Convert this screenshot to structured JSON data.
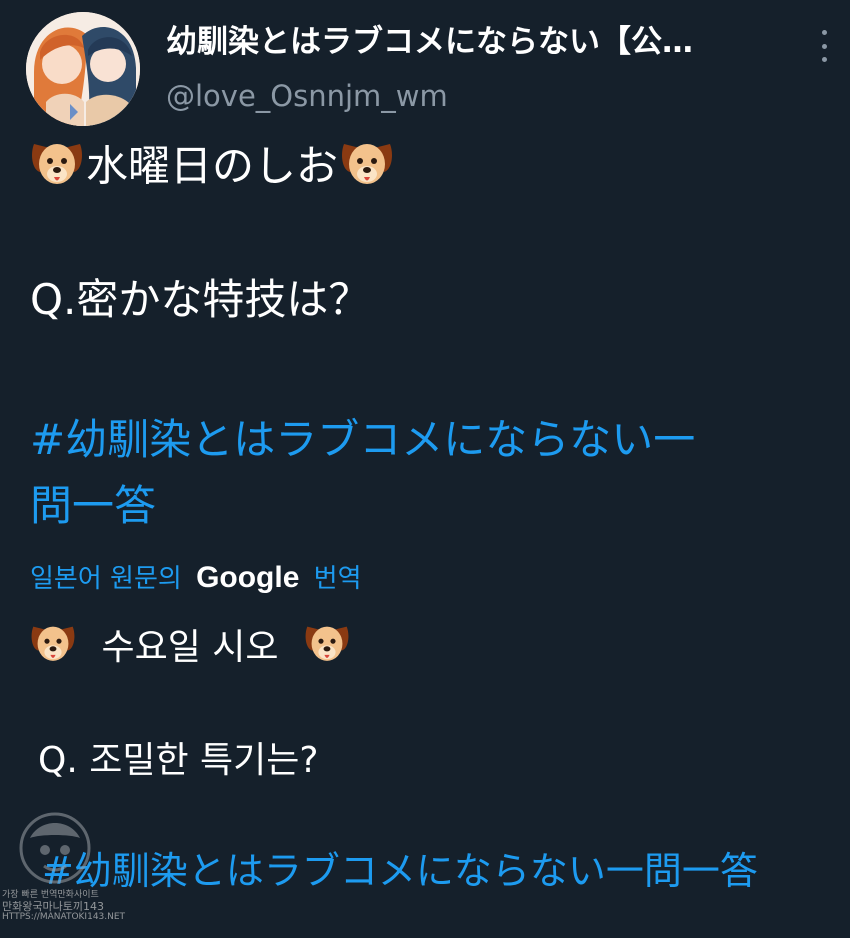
{
  "account": {
    "name": "幼馴染とはラブコメにならない【公…",
    "handle": "@love_Osnnjm_wm"
  },
  "tweet": {
    "line1": "水曜日のしお",
    "line2": "Q.密かな特技は？",
    "hashtag_line1": "#幼馴染とはラブコメにならない一",
    "hashtag_line2": "問一答"
  },
  "translation": {
    "prefix": "일본어 원문의",
    "provider": "Google",
    "suffix": "번역",
    "line1": "수요일 시오",
    "line2": "Q. 조밀한 특기는?",
    "hashtag": "#幼馴染とはラブコメにならない一問一答"
  },
  "watermark": {
    "line1": "가장 빠른 번역만화사이트",
    "line2": "만화왕국마나토끼143",
    "line3": "HTTPS://MANATOKI143.NET"
  },
  "icons": {
    "dog": "dog-face-emoji",
    "more": "more-vertical-icon"
  },
  "colors": {
    "background": "#15202b",
    "link": "#1d9bf0",
    "secondary_text": "#8b98a5"
  }
}
